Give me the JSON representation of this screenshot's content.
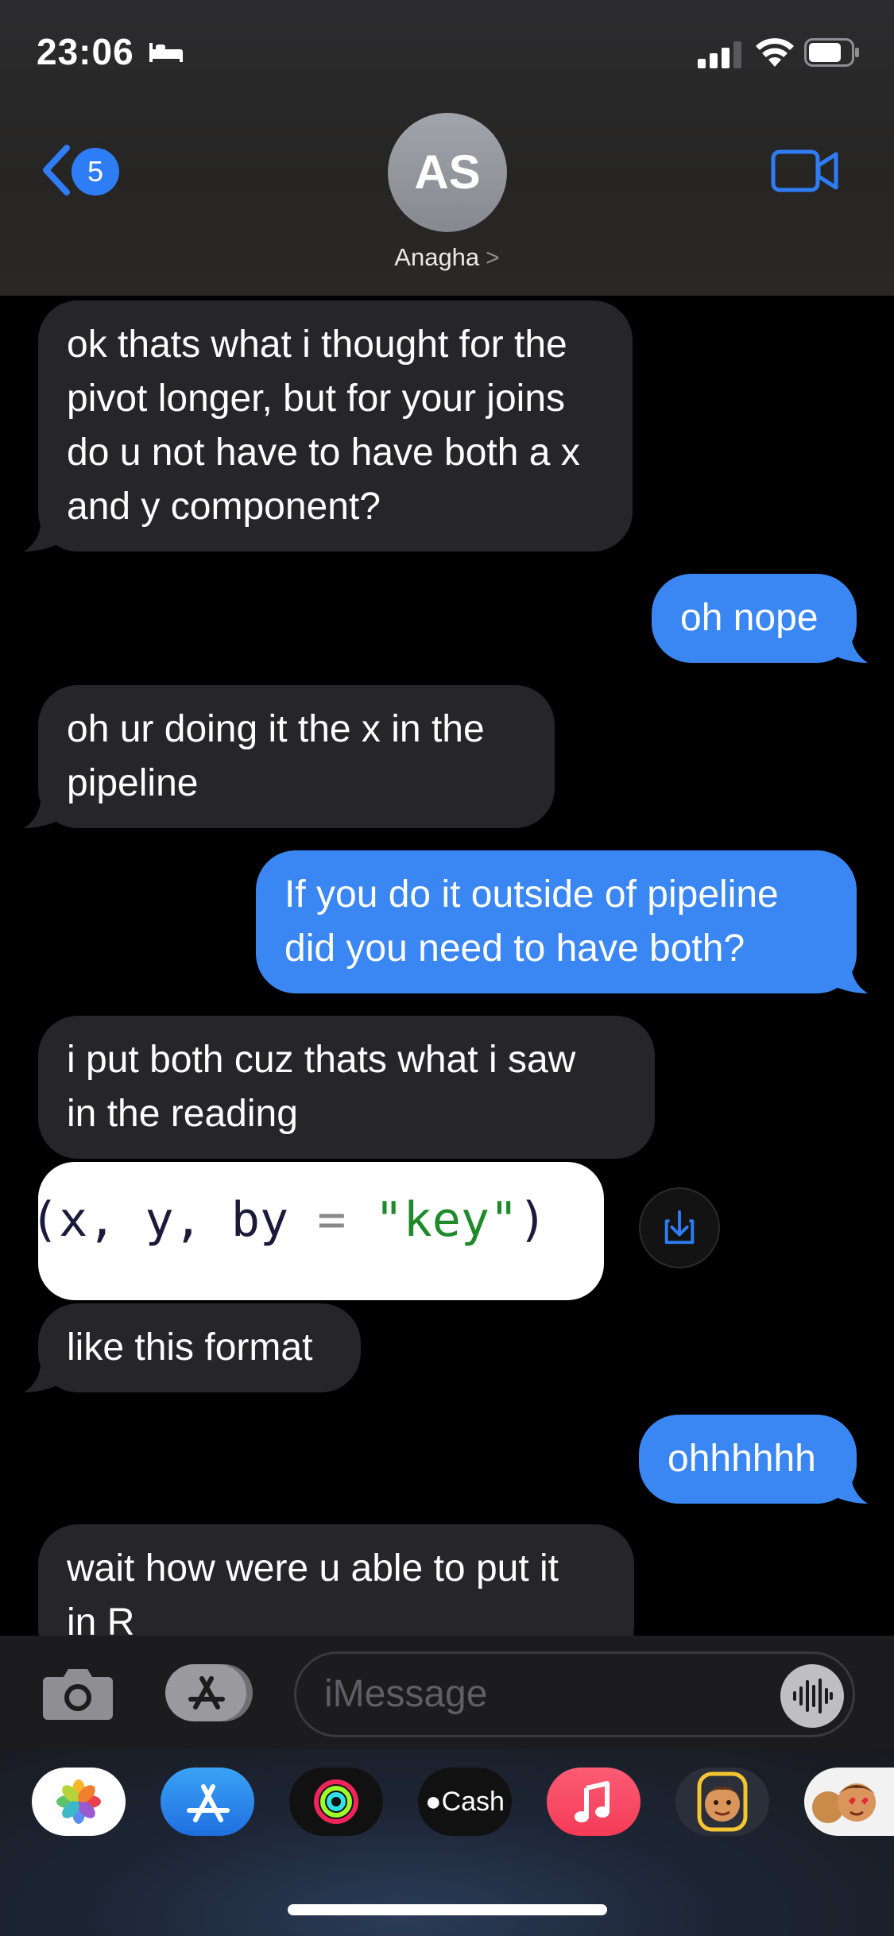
{
  "status_bar": {
    "time": "23:06"
  },
  "header": {
    "back_count": "5",
    "avatar_initials": "AS",
    "contact_name": "Anagha",
    "contact_chevron": ">"
  },
  "messages": [
    {
      "from": "them",
      "lines": [
        "ok thats what i thought for the",
        "pivot longer, but for your joins",
        "do u not have to have both a x",
        "and y component?"
      ]
    },
    {
      "from": "me",
      "lines": [
        "oh nope"
      ]
    },
    {
      "from": "them",
      "lines": [
        "oh ur doing it the x in the",
        "pipeline"
      ]
    },
    {
      "from": "me",
      "lines": [
        "If you do it outside of pipeline",
        "did you need to have both?"
      ]
    },
    {
      "from": "them",
      "lines": [
        "i put both cuz thats what i saw",
        "in the reading"
      ]
    },
    {
      "from": "them",
      "image_code": {
        "p1": "(x, y, by ",
        "eq": "=",
        "str": " \"key\"",
        "p2": ")"
      }
    },
    {
      "from": "them",
      "lines": [
        "like this format"
      ]
    },
    {
      "from": "me",
      "lines": [
        "ohhhhhh"
      ]
    },
    {
      "from": "them",
      "lines": [
        "wait how were u able to put it",
        "in R"
      ]
    }
  ],
  "composer": {
    "placeholder": "iMessage"
  },
  "app_drawer": {
    "apps": [
      "photos-app-icon",
      "app-store-icon",
      "fitness-app-icon",
      "apple-cash-icon",
      "music-app-icon",
      "memoji-icon",
      "memoji-stickers-icon"
    ],
    "cash_label": "Cash"
  },
  "colors": {
    "outgoing": "#3a87f4",
    "incoming": "#262628",
    "accent": "#2f7df6"
  }
}
